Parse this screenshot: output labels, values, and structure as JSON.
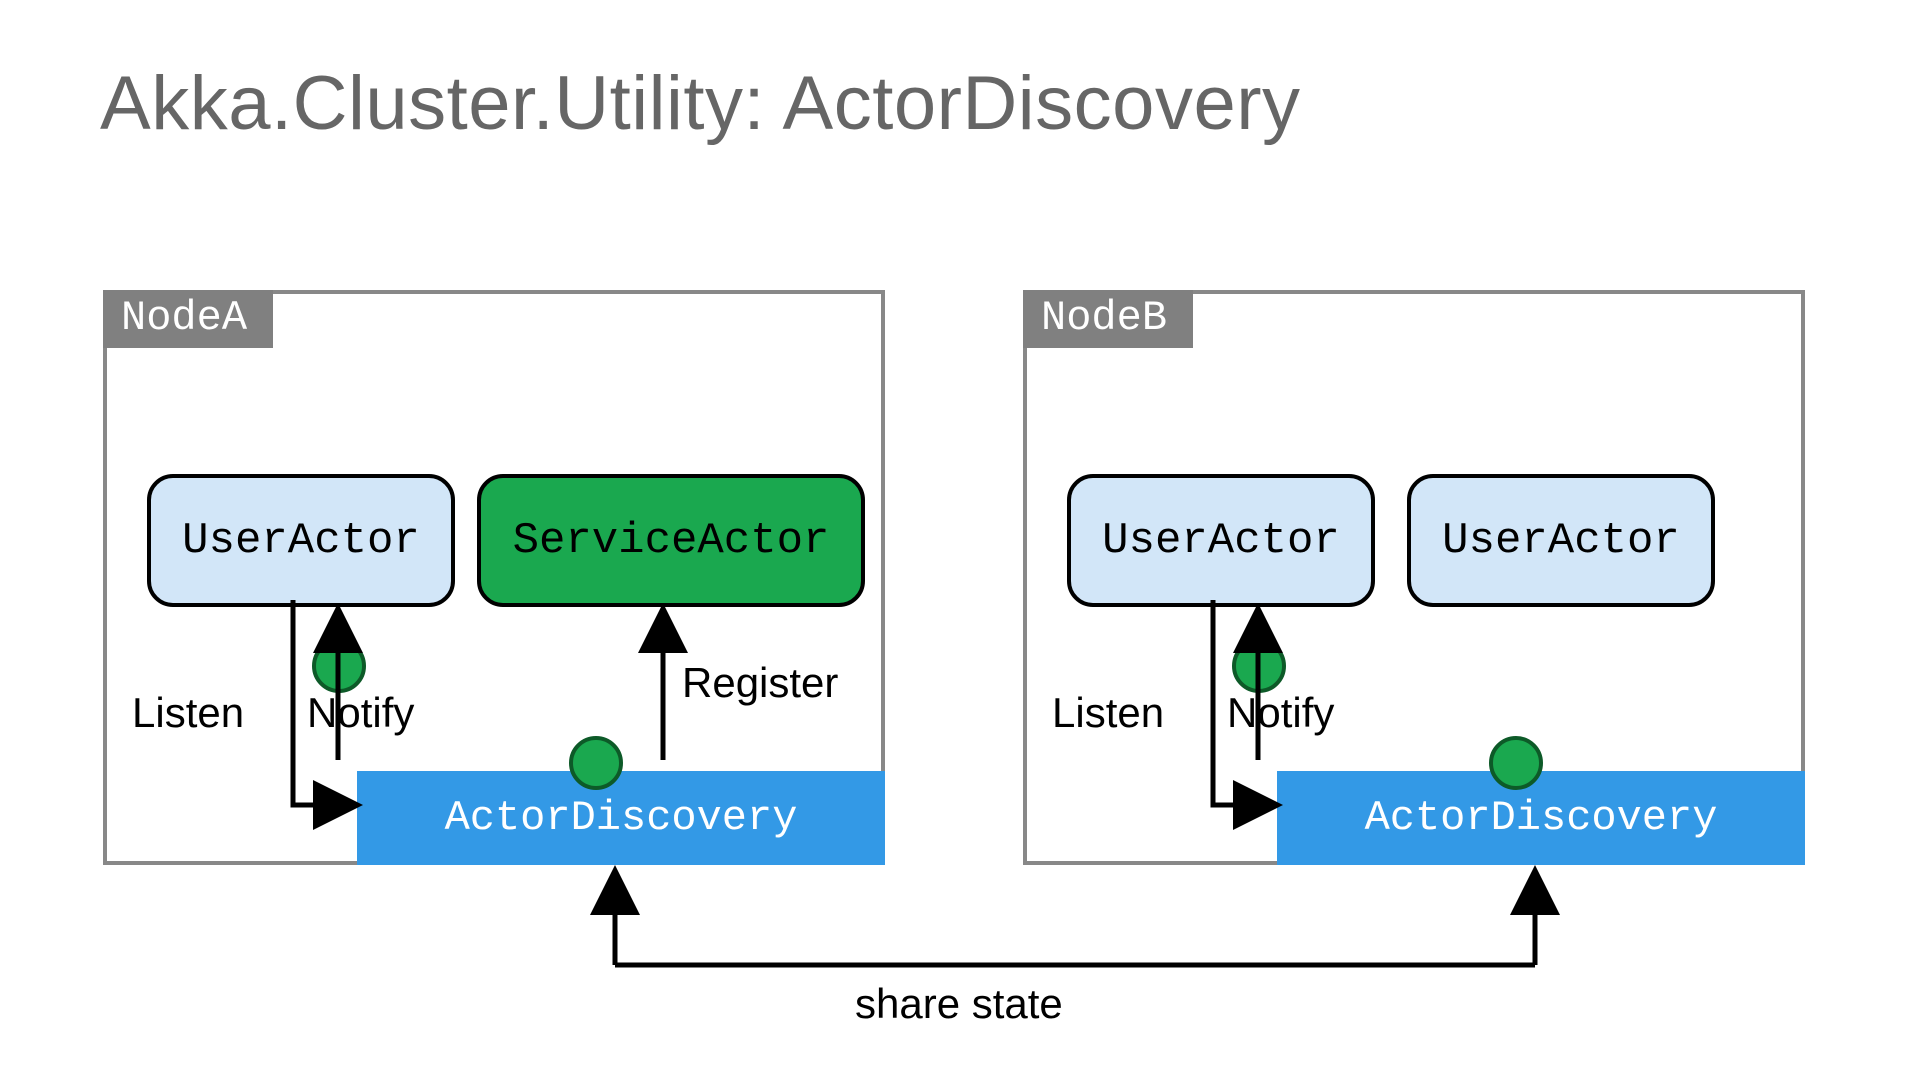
{
  "title": "Akka.Cluster.Utility: ActorDiscovery",
  "nodeA": {
    "label": "NodeA",
    "userActor": "UserActor",
    "serviceActor": "ServiceActor",
    "discovery": "ActorDiscovery",
    "listen": "Listen",
    "notify": "Notify",
    "register": "Register"
  },
  "nodeB": {
    "label": "NodeB",
    "userActor1": "UserActor",
    "userActor2": "UserActor",
    "discovery": "ActorDiscovery",
    "listen": "Listen",
    "notify": "Notify"
  },
  "shareState": "share state",
  "colors": {
    "nodeBorder": "#888888",
    "nodeLabelBg": "#808080",
    "actorBlue": "#d2e6f8",
    "actorGreen": "#1aa84f",
    "discoveryBlue": "#3399e6",
    "titleGray": "#666666"
  }
}
